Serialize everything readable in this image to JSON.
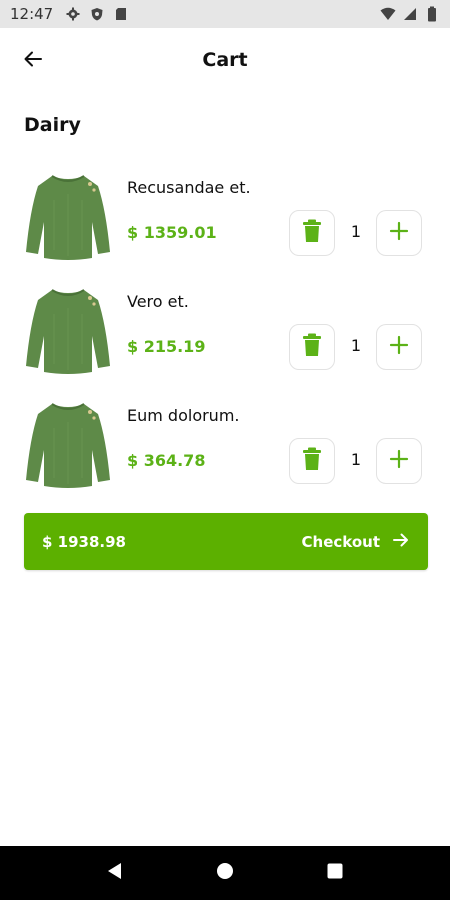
{
  "status_bar": {
    "time": "12:47",
    "left_icons": [
      "settings-icon",
      "shield-icon",
      "sd-card-icon"
    ],
    "right_icons": [
      "wifi-icon",
      "signal-icon",
      "battery-icon"
    ]
  },
  "app_bar": {
    "title": "Cart",
    "back_icon": "arrow-left-icon"
  },
  "section": {
    "title": "Dairy"
  },
  "items": [
    {
      "name": "Recusandae et.",
      "price": "$ 1359.01",
      "quantity": "1",
      "image": "green-sweater"
    },
    {
      "name": "Vero et.",
      "price": "$ 215.19",
      "quantity": "1",
      "image": "green-sweater"
    },
    {
      "name": "Eum dolorum.",
      "price": "$ 364.78",
      "quantity": "1",
      "image": "green-sweater"
    }
  ],
  "checkout": {
    "total": "$ 1938.98",
    "label": "Checkout",
    "icon": "arrow-right-icon"
  },
  "nav": {
    "back": "triangle-back-icon",
    "home": "circle-home-icon",
    "recents": "square-recents-icon"
  },
  "colors": {
    "accent": "#5cb217",
    "checkout_bg": "#5cb000",
    "status_bar_bg": "#e6e6e6",
    "nav_bar_bg": "#000000"
  }
}
